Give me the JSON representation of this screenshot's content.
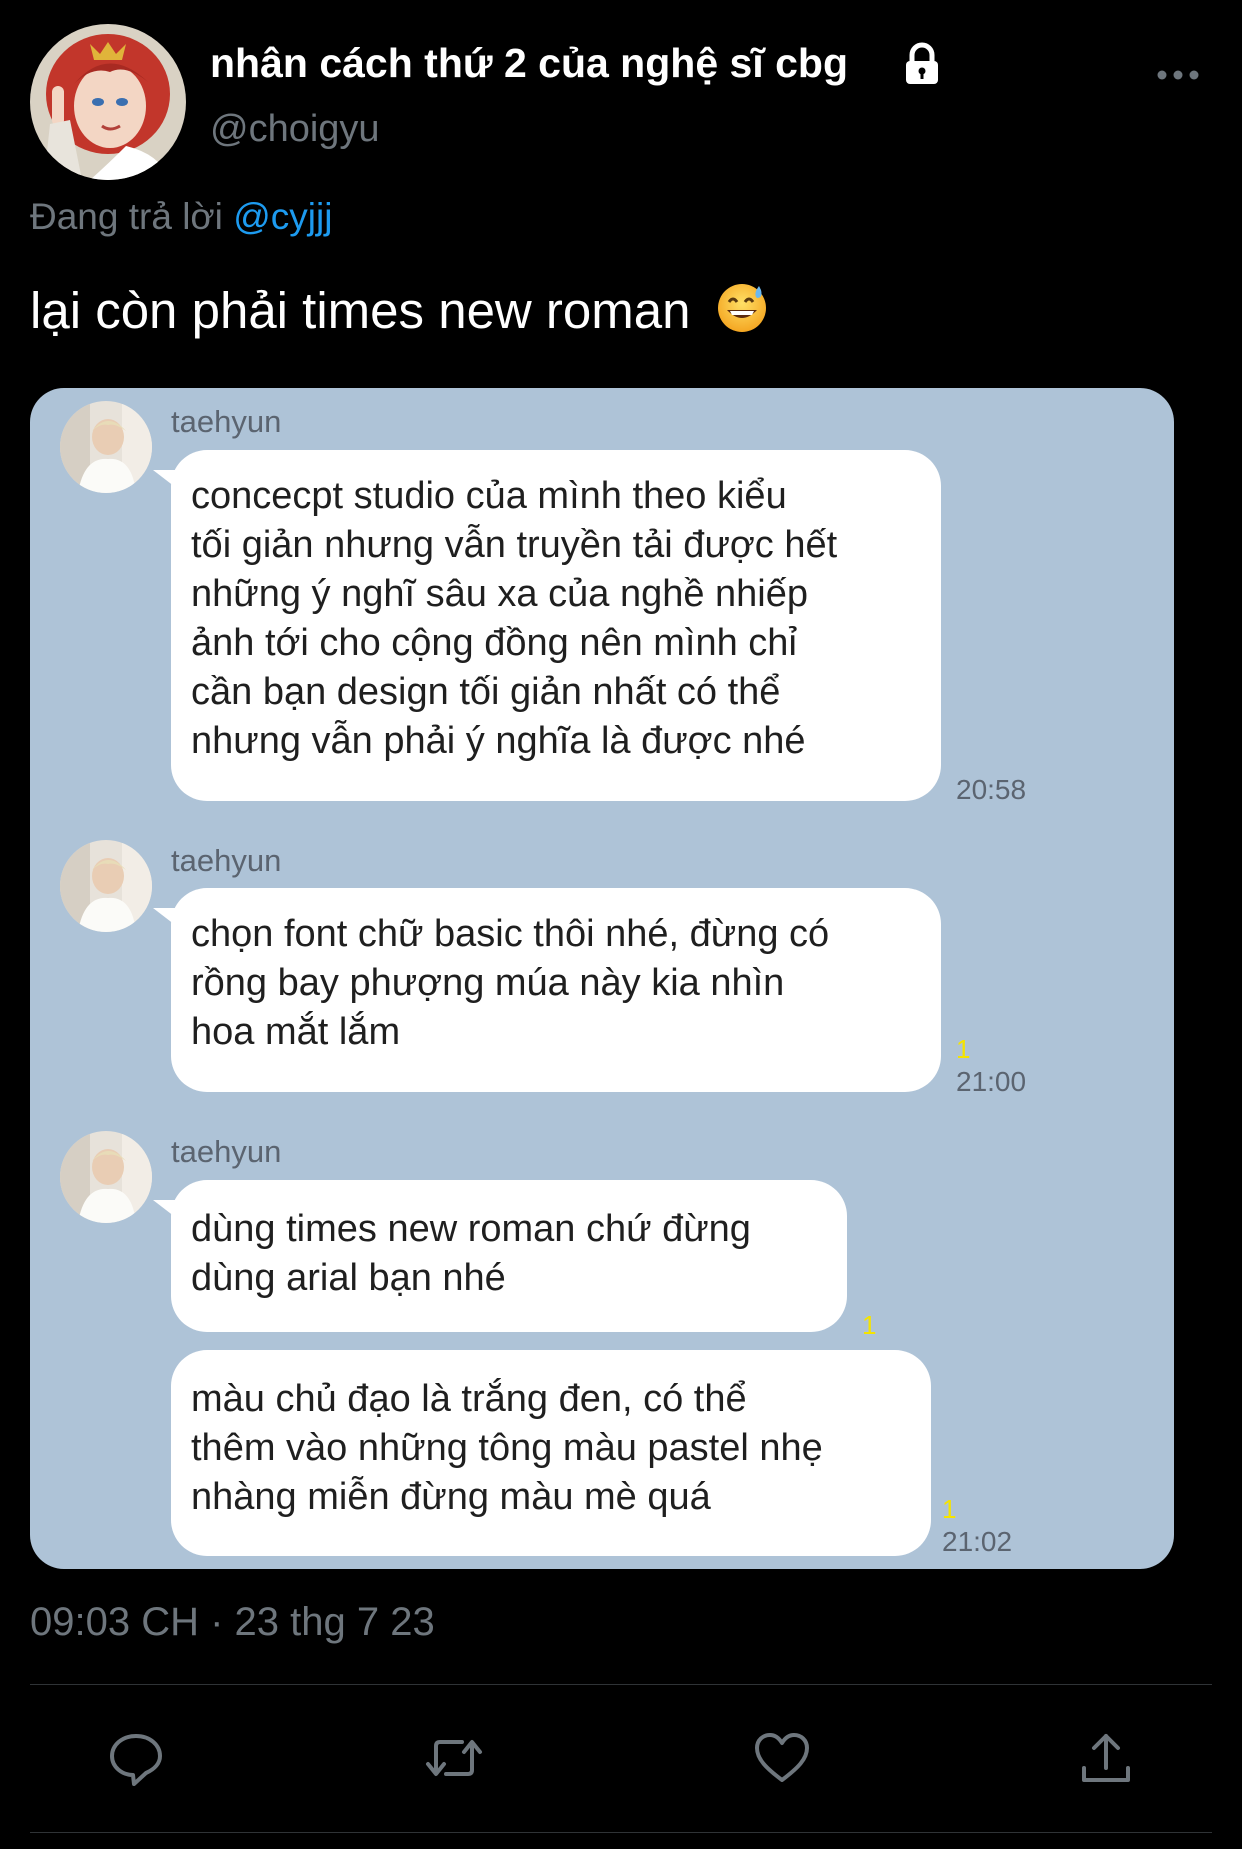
{
  "tweet": {
    "display_name": "nhân cách thứ 2 của nghệ sĩ cbg",
    "handle": "@choigyu",
    "reply_prefix": "Đang trả lời ",
    "reply_to": "@cyjjj",
    "text": "lại còn phải times new roman",
    "timestamp": "09:03 CH · 23 thg 7 23"
  },
  "chat": {
    "messages": [
      {
        "sender": "taehyun",
        "lines": [
          "concecpt studio của mình theo kiểu",
          "tối giản nhưng vẫn truyền tải được hết",
          "những ý nghĩ sâu xa của nghề nhiếp",
          "ảnh tới cho cộng đồng nên mình chỉ",
          "cần bạn design tối giản nhất có thể",
          "nhưng vẫn phải ý nghĩa là được nhé"
        ],
        "time": "20:58"
      },
      {
        "sender": "taehyun",
        "lines": [
          "chọn font chữ basic thôi nhé, đừng có",
          "rồng bay phượng múa này kia nhìn",
          "hoa mắt lắm"
        ],
        "read": "1",
        "time": "21:00"
      },
      {
        "sender": "taehyun",
        "lines": [
          "dùng times new roman chứ đừng",
          "dùng arial bạn nhé"
        ],
        "read": "1"
      },
      {
        "lines": [
          "màu chủ đạo là trắng đen, có thể",
          "thêm vào những tông màu pastel nhẹ",
          "nhàng miễn đừng màu mè quá"
        ],
        "read": "1",
        "time": "21:02"
      }
    ]
  },
  "icons": {
    "lock": "lock-icon",
    "more": "more-icon",
    "emoji": "grinning-sweat-emoji-icon",
    "reply": "reply-icon",
    "retweet": "retweet-icon",
    "like": "like-icon",
    "share": "share-icon"
  },
  "colors": {
    "background": "#000000",
    "link": "#1d9bf0",
    "muted": "#6e767d",
    "chat_background": "#aec3d7",
    "read_receipt": "#f5e400"
  }
}
